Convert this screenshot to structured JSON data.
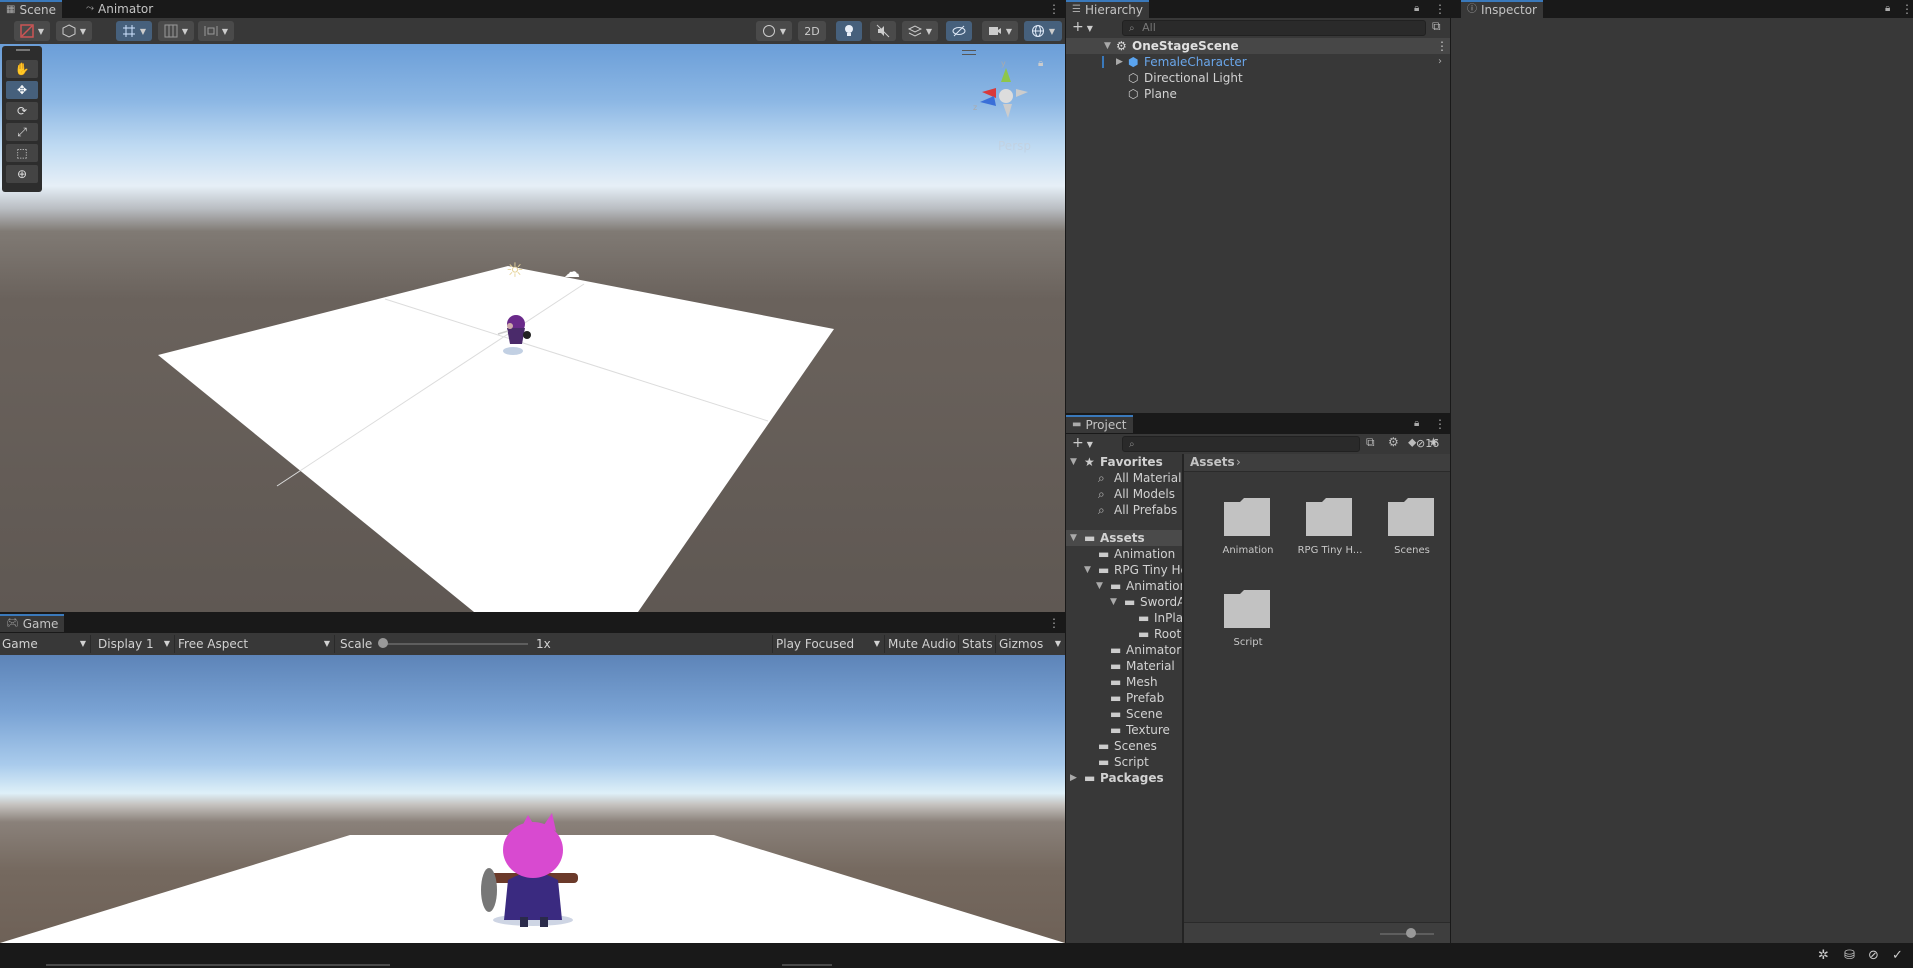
{
  "scene_panel": {
    "tabs": [
      {
        "label": "Scene",
        "icon": "grid-icon"
      },
      {
        "label": "Animator",
        "icon": "animator-icon"
      }
    ],
    "toolbar": {
      "btn_2d": "2D"
    },
    "tools": [
      "hand-tool-icon",
      "move-tool-icon",
      "rotate-tool-icon",
      "scale-tool-icon",
      "rect-tool-icon",
      "transform-tool-icon"
    ],
    "persp_label": "Persp"
  },
  "game_panel": {
    "tab": {
      "label": "Game",
      "icon": "gamepad-icon"
    },
    "toolbar": {
      "mode": "Game",
      "display": "Display 1",
      "aspect": "Free Aspect",
      "scale_label": "Scale",
      "scale_value": "1x",
      "play_mode": "Play Focused",
      "mute": "Mute Audio",
      "stats": "Stats",
      "gizmos": "Gizmos"
    }
  },
  "hierarchy": {
    "tab": {
      "label": "Hierarchy"
    },
    "search_placeholder": "All",
    "scene_name": "OneStageScene",
    "items": [
      {
        "label": "FemaleCharacter",
        "type": "prefab"
      },
      {
        "label": "Directional Light",
        "type": "gameobject"
      },
      {
        "label": "Plane",
        "type": "gameobject"
      }
    ]
  },
  "project": {
    "tab": {
      "label": "Project"
    },
    "hidden_count": "16",
    "favorites_label": "Favorites",
    "favorites": [
      "All Materials",
      "All Models",
      "All Prefabs"
    ],
    "assets_label": "Assets",
    "tree": [
      {
        "label": "Animation",
        "depth": 1
      },
      {
        "label": "RPG Tiny Hero",
        "depth": 1
      },
      {
        "label": "Animation",
        "depth": 2
      },
      {
        "label": "SwordAndShield",
        "depth": 3
      },
      {
        "label": "InPlace",
        "depth": 4
      },
      {
        "label": "RootMotion",
        "depth": 4
      },
      {
        "label": "Animator",
        "depth": 2
      },
      {
        "label": "Material",
        "depth": 2
      },
      {
        "label": "Mesh",
        "depth": 2
      },
      {
        "label": "Prefab",
        "depth": 2
      },
      {
        "label": "Scene",
        "depth": 2
      },
      {
        "label": "Texture",
        "depth": 2
      },
      {
        "label": "Scenes",
        "depth": 1
      },
      {
        "label": "Script",
        "depth": 1
      }
    ],
    "packages_label": "Packages",
    "breadcrumb": "Assets",
    "grid_items": [
      "Animation",
      "RPG Tiny H...",
      "Scenes",
      "Script"
    ]
  },
  "inspector": {
    "tab": {
      "label": "Inspector"
    }
  },
  "colors": {
    "panel_bg": "#383838",
    "tab_bar_bg": "#191919",
    "accent": "#3a79bb",
    "selection_text": "#6aa6ea"
  }
}
